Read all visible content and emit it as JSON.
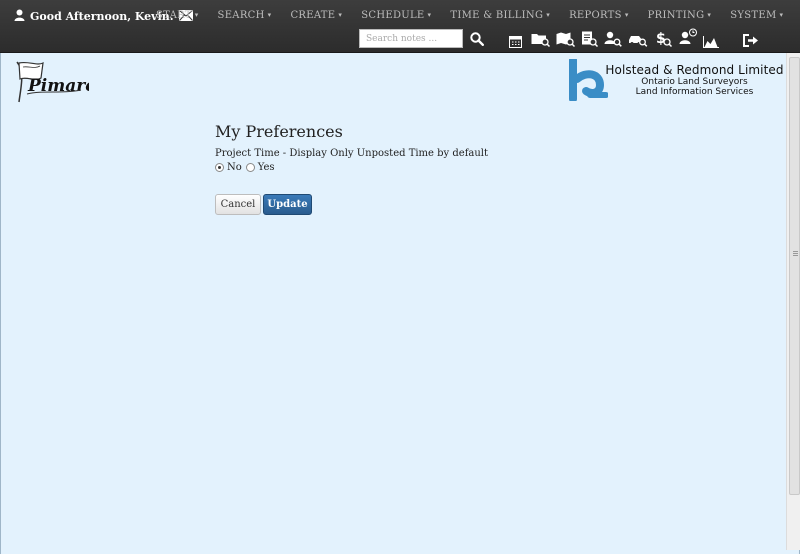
{
  "user": {
    "greeting": "Good Afternoon, Kevin."
  },
  "nav": {
    "items": [
      {
        "label": "START"
      },
      {
        "label": "SEARCH"
      },
      {
        "label": "CREATE"
      },
      {
        "label": "SCHEDULE"
      },
      {
        "label": "TIME & BILLING"
      },
      {
        "label": "REPORTS"
      },
      {
        "label": "PRINTING"
      },
      {
        "label": "SYSTEM"
      }
    ],
    "caret": "▾"
  },
  "search": {
    "placeholder": "Search notes ...",
    "value": ""
  },
  "toolbar_icons": [
    "search-icon",
    "calendar-icon",
    "folder-search-icon",
    "map-search-icon",
    "document-search-icon",
    "person-search-icon",
    "vehicle-search-icon",
    "billing-search-icon",
    "user-clock-icon",
    "chart-icon",
    "logout-icon"
  ],
  "branding": {
    "app_logo": "Pimarc",
    "company_name": "Holstead & Redmond Limited",
    "company_line2": "Ontario Land Surveyors",
    "company_line3": "Land Information Services",
    "brand_color": "#3a8dc6"
  },
  "page": {
    "title": "My Preferences",
    "pref_label": "Project Time - Display Only Unposted Time by default",
    "options": [
      {
        "label": "No",
        "checked": true
      },
      {
        "label": "Yes",
        "checked": false
      }
    ],
    "cancel_label": "Cancel",
    "update_label": "Update"
  },
  "colors": {
    "navbar": "#333333",
    "background": "#e3f2fd",
    "primary_button": "#2e6aa3"
  }
}
